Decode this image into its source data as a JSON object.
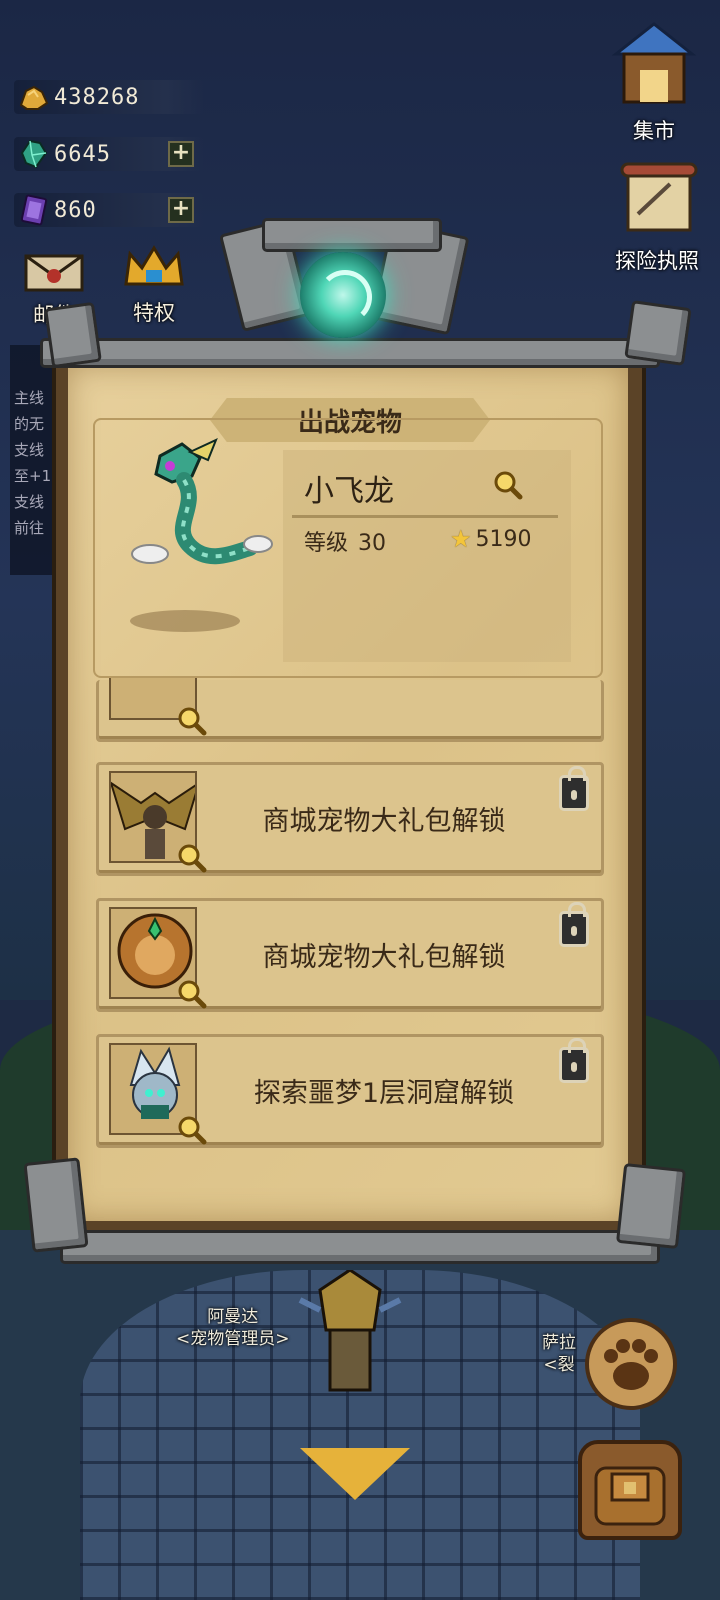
{
  "currency": {
    "gold": "438268",
    "gems": "6645",
    "cards": "860",
    "plus_label": "+"
  },
  "top_buttons": {
    "mail": "邮件",
    "privilege": "特权",
    "market": "集市",
    "adventure_license": "探险执照"
  },
  "quest_panel": {
    "lines": [
      "主线",
      "的无",
      "支线",
      "至+1",
      "支线",
      "前往"
    ]
  },
  "panel": {
    "title": "出战宠物",
    "featured": {
      "name": "小飞龙",
      "level_label": "等级",
      "level": "30",
      "power": "5190"
    },
    "slots": [
      {
        "unlock_text": "商城宠物大礼包解锁",
        "locked": true
      },
      {
        "unlock_text": "商城宠物大礼包解锁",
        "locked": true
      },
      {
        "unlock_text": "探索噩梦1层洞窟解锁",
        "locked": true
      }
    ]
  },
  "npcs": {
    "left_name": "阿曼达",
    "left_title": "<宠物管理员>",
    "right_name": "萨拉",
    "right_title": "<裂"
  },
  "colors": {
    "paper": "#e2ca92",
    "frame": "#5b4327",
    "accent_gold": "#e6b23a",
    "portal": "#4fd6b6"
  }
}
